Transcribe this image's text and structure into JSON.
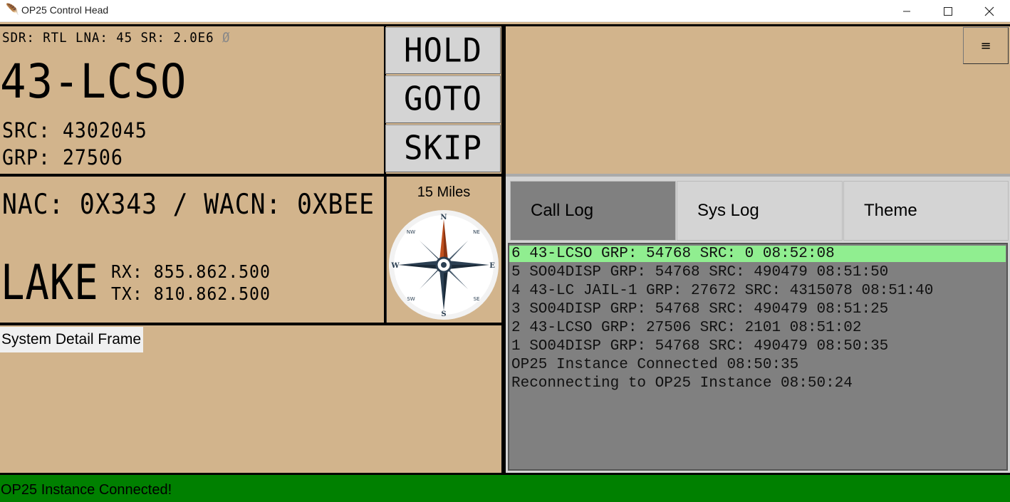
{
  "window": {
    "title": "OP25 Control Head",
    "icon": "feather-icon",
    "minimize": "—",
    "maximize": "☐",
    "close": "✕"
  },
  "tuner": {
    "status_line": "SDR: RTL  LNA: 45  SR: 2.0E6",
    "status_symbol": "Ø",
    "talkgroup": "43-LCSO",
    "src": "SRC: 4302045",
    "grp": "GRP: 27506"
  },
  "controls": {
    "hold": "HOLD",
    "goto": "GOTO",
    "skip": "SKIP"
  },
  "menu_icon": "≡",
  "system": {
    "nac_wacn": "NAC: 0X343 / WACN: 0XBEE",
    "site_name": "LAKE",
    "rx": "RX: 855.862.500",
    "tx": "TX: 810.862.500",
    "distance": "15 Miles"
  },
  "compass": {
    "n": "N",
    "s": "S",
    "e": "E",
    "w": "W",
    "ne": "NE",
    "nw": "NW",
    "se": "SE",
    "sw": "SW"
  },
  "detail_frame_label": "System Detail Frame",
  "tabs": [
    {
      "label": "Call Log",
      "active": true
    },
    {
      "label": "Sys Log",
      "active": false
    },
    {
      "label": "Theme",
      "active": false
    }
  ],
  "call_log": [
    "6 43-LCSO GRP: 54768 SRC: 0 08:52:08",
    "5 SO04DISP GRP: 54768 SRC: 490479 08:51:50",
    "4 43-LC JAIL-1 GRP: 27672 SRC: 4315078 08:51:40",
    "3 SO04DISP GRP: 54768 SRC: 490479 08:51:25",
    "2 43-LCSO GRP: 27506 SRC: 2101 08:51:02",
    "1 SO04DISP GRP: 54768 SRC: 490479 08:50:35",
    "OP25 Instance Connected 08:50:35",
    "Reconnecting to OP25 Instance 08:50:24"
  ],
  "status_bar": "OP25 Instance Connected!",
  "colors": {
    "panel": "#d2b48c",
    "highlight": "#90ee90",
    "log_bg": "#808080",
    "status_bar": "#008000",
    "active_tab": "#808080",
    "inactive_tab": "#d4d4d4"
  }
}
